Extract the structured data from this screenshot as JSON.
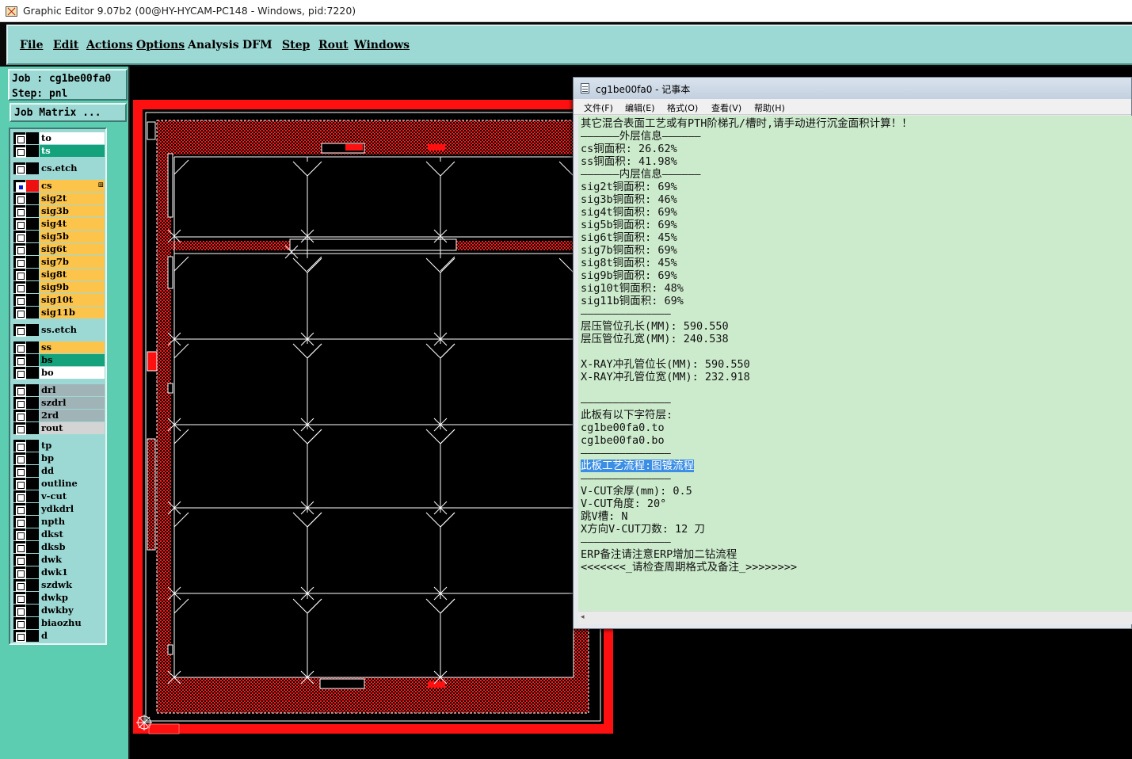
{
  "window": {
    "title": "Graphic Editor 9.07b2 (00@HY-HYCAM-PC148 - Windows, pid:7220)"
  },
  "menu": [
    {
      "label": "File",
      "underline": true
    },
    {
      "label": "Edit",
      "underline": true
    },
    {
      "label": "Actions",
      "underline": true
    },
    {
      "label": "Options",
      "underline": true
    },
    {
      "label": "Analysis",
      "underline": false
    },
    {
      "label": "DFM",
      "underline": false
    },
    {
      "label": "Step",
      "underline": true
    },
    {
      "label": "Rout",
      "underline": true
    },
    {
      "label": "Windows",
      "underline": true
    }
  ],
  "job_info": {
    "job_line": "Job : cg1be00fa0",
    "step_line": "Step: pnl",
    "job_matrix_button": "Job Matrix ..."
  },
  "layers": [
    {
      "name": "to",
      "color": "#ffffff",
      "group": 0
    },
    {
      "name": "ts",
      "color": "#14a27c",
      "group": 0
    },
    {
      "name": "cs.etch",
      "color": "#9dd9d4",
      "group": 1
    },
    {
      "name": "cs",
      "color": "#fdc44c",
      "group": 2,
      "active": true,
      "work": true
    },
    {
      "name": "sig2t",
      "color": "#fdc44c",
      "group": 2
    },
    {
      "name": "sig3b",
      "color": "#fdc44c",
      "group": 2
    },
    {
      "name": "sig4t",
      "color": "#fdc44c",
      "group": 2
    },
    {
      "name": "sig5b",
      "color": "#fdc44c",
      "group": 2
    },
    {
      "name": "sig6t",
      "color": "#fdc44c",
      "group": 2
    },
    {
      "name": "sig7b",
      "color": "#fdc44c",
      "group": 2
    },
    {
      "name": "sig8t",
      "color": "#fdc44c",
      "group": 2
    },
    {
      "name": "sig9b",
      "color": "#fdc44c",
      "group": 2
    },
    {
      "name": "sig10t",
      "color": "#fdc44c",
      "group": 2
    },
    {
      "name": "sig11b",
      "color": "#fdc44c",
      "group": 2
    },
    {
      "name": "ss.etch",
      "color": "#9dd9d4",
      "group": 3
    },
    {
      "name": "ss",
      "color": "#fdc44c",
      "group": 4
    },
    {
      "name": "bs",
      "color": "#14a27c",
      "group": 4
    },
    {
      "name": "bo",
      "color": "#ffffff",
      "group": 4
    },
    {
      "name": "drl",
      "color": "#a0b4b8",
      "group": 5
    },
    {
      "name": "szdrl",
      "color": "#a0b4b8",
      "group": 5
    },
    {
      "name": "2rd",
      "color": "#a0b4b8",
      "group": 5
    },
    {
      "name": "rout",
      "color": "#d4d4d4",
      "group": 5
    },
    {
      "name": "tp",
      "color": "#9dd9d4",
      "group": 6
    },
    {
      "name": "bp",
      "color": "#9dd9d4",
      "group": 6
    },
    {
      "name": "dd",
      "color": "#9dd9d4",
      "group": 6
    },
    {
      "name": "outline",
      "color": "#9dd9d4",
      "group": 6
    },
    {
      "name": "v-cut",
      "color": "#9dd9d4",
      "group": 6
    },
    {
      "name": "ydkdrl",
      "color": "#9dd9d4",
      "group": 6
    },
    {
      "name": "npth",
      "color": "#9dd9d4",
      "group": 6
    },
    {
      "name": "dkst",
      "color": "#9dd9d4",
      "group": 6
    },
    {
      "name": "dksb",
      "color": "#9dd9d4",
      "group": 6
    },
    {
      "name": "dwk",
      "color": "#9dd9d4",
      "group": 6
    },
    {
      "name": "dwk1",
      "color": "#9dd9d4",
      "group": 6
    },
    {
      "name": "szdwk",
      "color": "#9dd9d4",
      "group": 6
    },
    {
      "name": "dwkp",
      "color": "#9dd9d4",
      "group": 6
    },
    {
      "name": "dwkby",
      "color": "#9dd9d4",
      "group": 6
    },
    {
      "name": "biaozhu",
      "color": "#9dd9d4",
      "group": 6
    },
    {
      "name": "d",
      "color": "#9dd9d4",
      "group": 6
    }
  ],
  "work_layer_marker": "⊞",
  "notepad": {
    "title": "cg1be00fa0 - 记事本",
    "menu": [
      "文件(F)",
      "编辑(E)",
      "格式(O)",
      "查看(V)",
      "帮助(H)"
    ],
    "lines": [
      "其它混合表面工艺或有PTH阶梯孔/槽时,请手动进行沉金面积计算！！",
      "――――――外层信息――――――",
      "cs铜面积: 26.62%",
      "ss铜面积: 41.98%",
      "――――――内层信息――――――",
      "sig2t铜面积: 69%",
      "sig3b铜面积: 46%",
      "sig4t铜面积: 69%",
      "sig5b铜面积: 69%",
      "sig6t铜面积: 45%",
      "sig7b铜面积: 69%",
      "sig8t铜面积: 45%",
      "sig9b铜面积: 69%",
      "sig10t铜面积: 48%",
      "sig11b铜面积: 69%",
      "――――――――――――――",
      "层压管位孔长(MM): 590.550",
      "层压管位孔宽(MM): 240.538",
      "",
      "X-RAY冲孔管位长(MM): 590.550",
      "X-RAY冲孔管位宽(MM): 232.918",
      "",
      "――――――――――――――",
      "此板有以下字符层:",
      "cg1be00fa0.to",
      "cg1be00fa0.bo",
      "――――――――――――――",
      "此板工艺流程:图镀流程",
      "――――――――――――――",
      "V-CUT余厚(mm): 0.5",
      "V-CUT角度: 20°",
      "跳V槽: N",
      "X方向V-CUT刀数: 12 刀",
      "――――――――――――――",
      "ERP备注请注意ERP增加二钻流程",
      "<<<<<<<_请检查周期格式及备注_>>>>>>>>"
    ],
    "highlighted_line": 27
  },
  "colors": {
    "panel_teal": "#9dd9d4",
    "left_bg": "#5ccdb0",
    "profile_red": "#ff1010",
    "selection_blue": "#3b8ee4",
    "notepad_bg": "#ccebcc"
  }
}
